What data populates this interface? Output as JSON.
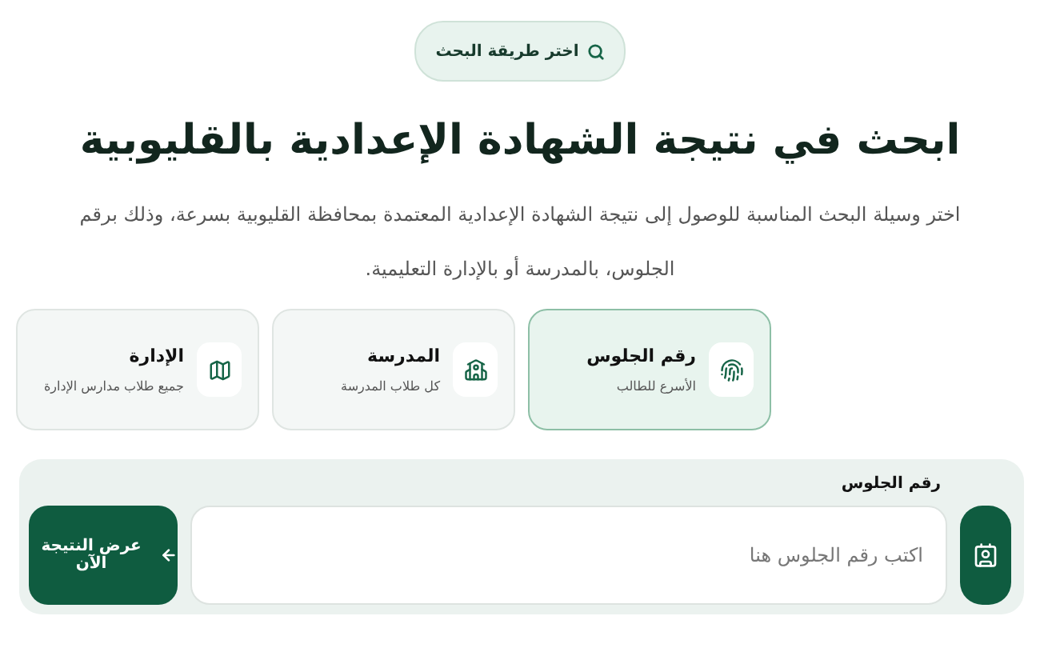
{
  "badge": {
    "label": "اختر طريقة البحث"
  },
  "heading": "ابحث في نتيجة الشهادة الإعدادية بالقليوبية",
  "description": "اختر وسيلة البحث المناسبة للوصول إلى نتيجة الشهادة الإعدادية المعتمدة بمحافظة القليوبية بسرعة، وذلك برقم الجلوس، بالمدرسة أو بالإدارة التعليمية.",
  "methods": [
    {
      "kind": "seat",
      "title": "رقم الجلوس",
      "subtitle": "الأسرع للطالب",
      "selected": true
    },
    {
      "kind": "school",
      "title": "المدرسة",
      "subtitle": "كل طلاب المدرسة",
      "selected": false
    },
    {
      "kind": "admin",
      "title": "الإدارة",
      "subtitle": "جميع طلاب مدارس الإدارة",
      "selected": false
    }
  ],
  "search": {
    "label": "رقم الجلوس",
    "placeholder": "اكتب رقم الجلوس هنا",
    "button": "عرض النتيجة الآن"
  }
}
